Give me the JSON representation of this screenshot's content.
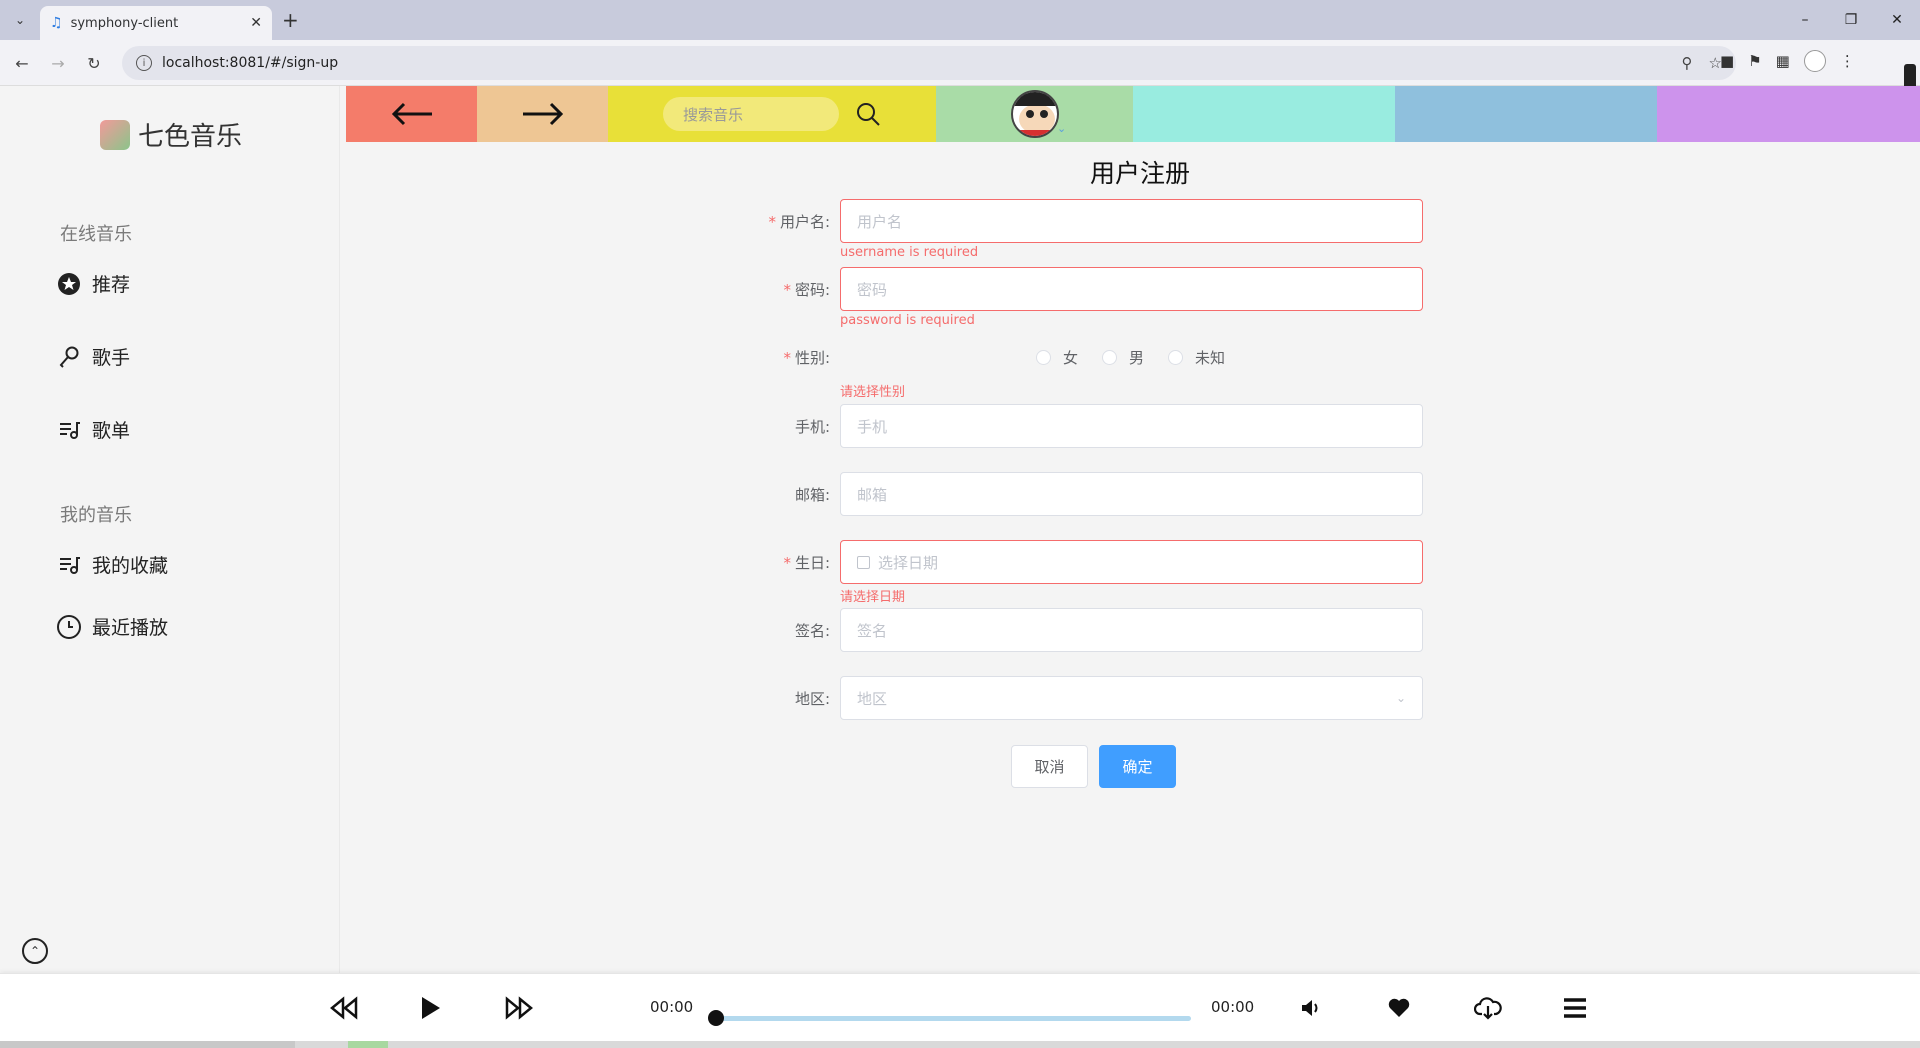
{
  "browser": {
    "tab_title": "symphony-client",
    "url": "localhost:8081/#/sign-up",
    "win_min": "–",
    "win_restore": "❐",
    "win_close": "✕",
    "new_tab": "+",
    "tab_close": "✕",
    "tab_menu": "⌄"
  },
  "sidebar": {
    "logo_text": "七色音乐",
    "group_online": "在线音乐",
    "group_mine": "我的音乐",
    "items": [
      {
        "label": "推荐",
        "icon": "star-circle-icon"
      },
      {
        "label": "歌手",
        "icon": "microphone-icon"
      },
      {
        "label": "歌单",
        "icon": "playlist-icon"
      },
      {
        "label": "我的收藏",
        "icon": "playlist-icon"
      },
      {
        "label": "最近播放",
        "icon": "clock-icon"
      }
    ]
  },
  "header": {
    "search_placeholder": "搜索音乐",
    "back_glyph": "←",
    "forward_glyph": "→",
    "colors": [
      "#f47c6a",
      "#eec694",
      "#e8e038",
      "#a9dca7",
      "#99ece0",
      "#8fc0dd",
      "#cd93ec"
    ]
  },
  "form": {
    "title": "用户注册",
    "username_label": "用户名:",
    "username_placeholder": "用户名",
    "username_error": "username is required",
    "password_label": "密码:",
    "password_placeholder": "密码",
    "password_error": "password is required",
    "gender_label": "性别:",
    "gender_options": [
      "女",
      "男",
      "未知"
    ],
    "gender_error": "请选择性别",
    "phone_label": "手机:",
    "phone_placeholder": "手机",
    "email_label": "邮箱:",
    "email_placeholder": "邮箱",
    "birthday_label": "生日:",
    "birthday_placeholder": "选择日期",
    "birthday_error": "请选择日期",
    "signature_label": "签名:",
    "signature_placeholder": "签名",
    "region_label": "地区:",
    "region_placeholder": "地区",
    "cancel_label": "取消",
    "confirm_label": "确定",
    "required_mark": "*"
  },
  "player": {
    "current_time": "00:00",
    "total_time": "00:00",
    "progress": 0
  }
}
